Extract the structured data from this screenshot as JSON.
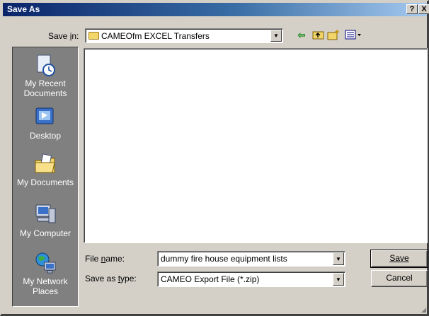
{
  "window": {
    "title": "Save As",
    "help_label": "?",
    "close_label": "X"
  },
  "toolbar": {
    "save_in_label": "Save in:",
    "save_in_value": "CAMEOfm EXCEL Transfers",
    "icons": [
      "back-icon",
      "up-folder-icon",
      "new-folder-icon",
      "views-menu-icon"
    ]
  },
  "places": [
    {
      "label": "My Recent Documents",
      "icon": "recent-documents-icon"
    },
    {
      "label": "Desktop",
      "icon": "desktop-icon"
    },
    {
      "label": "My Documents",
      "icon": "my-documents-icon"
    },
    {
      "label": "My Computer",
      "icon": "my-computer-icon"
    },
    {
      "label": "My Network Places",
      "icon": "network-places-icon"
    }
  ],
  "form": {
    "file_name_label": "File name:",
    "file_name_value": "dummy fire house equipment lists",
    "save_as_type_label": "Save as type:",
    "save_as_type_value": "CAMEO Export File (*.zip)"
  },
  "buttons": {
    "save_label": "Save",
    "cancel_label": "Cancel"
  }
}
